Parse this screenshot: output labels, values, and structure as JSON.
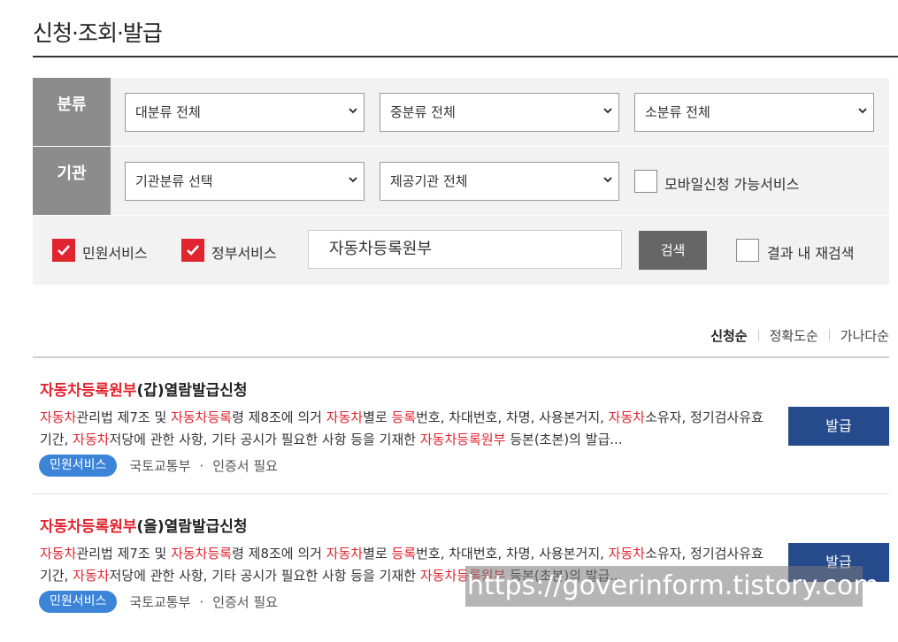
{
  "page": {
    "title": "신청·조회·발급"
  },
  "filters": {
    "category_label": "분류",
    "agency_label": "기관",
    "major_category": "대분류 전체",
    "middle_category": "중분류 전체",
    "minor_category": "소분류 전체",
    "agency_type": "기관분류 선택",
    "provider_agency": "제공기관 전체",
    "mobile_label": "모바일신청 가능서비스",
    "civil_service_label": "민원서비스",
    "gov_service_label": "정부서비스",
    "search_value": "자동차등록원부",
    "search_button": "검색",
    "research_label": "결과 내 재검색"
  },
  "sort": {
    "items": [
      "신청순",
      "정확도순",
      "가나다순"
    ],
    "active": "신청순"
  },
  "results": [
    {
      "title_hl": "자동차등록원부",
      "title_rest": "(갑)열람발급신청",
      "desc": [
        {
          "t": "자동차",
          "h": true
        },
        {
          "t": "관리법 제7조 및 "
        },
        {
          "t": "자동차등록",
          "h": true
        },
        {
          "t": "령 제8조에 의거 "
        },
        {
          "t": "자동차",
          "h": true
        },
        {
          "t": "별로 "
        },
        {
          "t": "등록",
          "h": true
        },
        {
          "t": "번호, 차대번호, 차명, 사용본거지, "
        },
        {
          "t": "자동차",
          "h": true
        },
        {
          "t": "소유자, 정기검사유효기간, "
        },
        {
          "t": "자동차",
          "h": true
        },
        {
          "t": "저당에 관한 사항, 기타 공시가 필요한 사항 등을 기재한 "
        },
        {
          "t": "자동차등록원부",
          "h": true
        },
        {
          "t": " 등본(초본)의 발급..."
        }
      ],
      "badge": "민원서비스",
      "org": "국토교통부",
      "dot": "·",
      "cert": "인증서 필요",
      "button": "발급"
    },
    {
      "title_hl": "자동차등록원부",
      "title_rest": "(을)열람발급신청",
      "desc": [
        {
          "t": "자동차",
          "h": true
        },
        {
          "t": "관리법 제7조 및 "
        },
        {
          "t": "자동차등록",
          "h": true
        },
        {
          "t": "령 제8조에 의거 "
        },
        {
          "t": "자동차",
          "h": true
        },
        {
          "t": "별로 "
        },
        {
          "t": "등록",
          "h": true
        },
        {
          "t": "번호, 차대번호, 차명, 사용본거지, "
        },
        {
          "t": "자동차",
          "h": true
        },
        {
          "t": "소유자, 정기검사유효기간, "
        },
        {
          "t": "자동차",
          "h": true
        },
        {
          "t": "저당에 관한 사항, 기타 공시가 필요한 사항 등을 기재한 "
        },
        {
          "t": "자동차등록원부",
          "h": true
        },
        {
          "t": " 등본(초본)의 발급..."
        }
      ],
      "badge": "민원서비스",
      "org": "국토교통부",
      "dot": "·",
      "cert": "인증서 필요",
      "button": "발급"
    }
  ],
  "watermark": "https://goverinform.tistory.com",
  "colors": {
    "highlight": "#e0252f",
    "issue_button": "#264b8c",
    "badge": "#3b84d8",
    "check": "#e0252f"
  }
}
